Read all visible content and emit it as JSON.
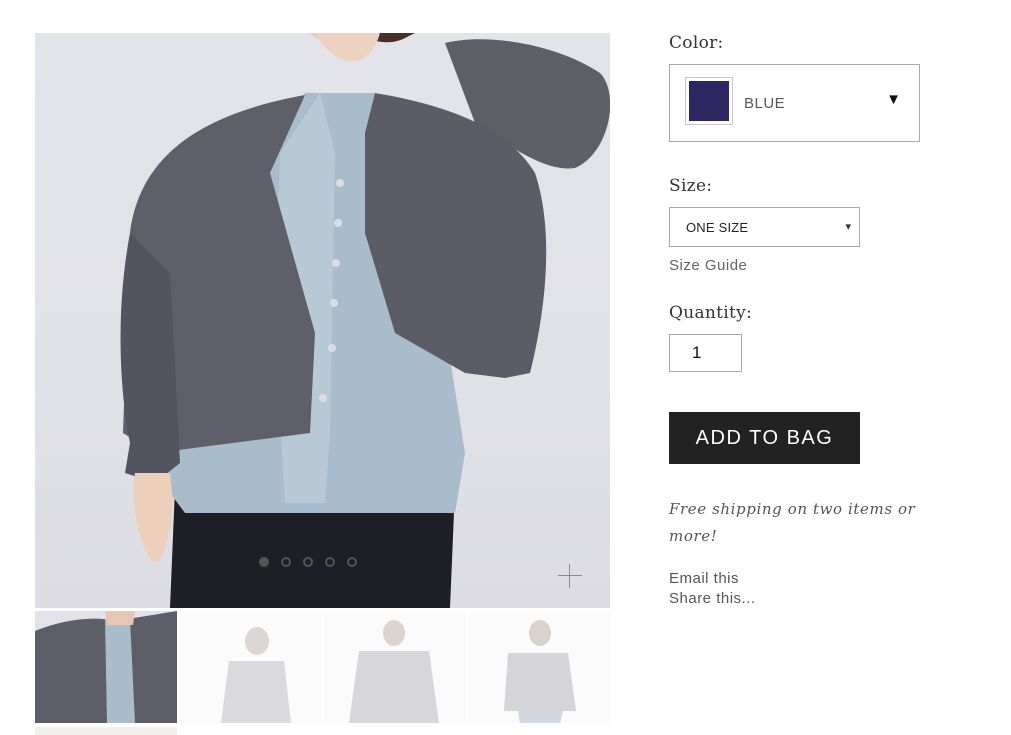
{
  "gallery": {
    "dot_count": 5,
    "active_dot": 0,
    "zoom_icon": "plus-icon"
  },
  "options": {
    "color": {
      "label": "Color:",
      "selected": "BLUE",
      "swatch_hex": "#2d2761",
      "caret_icon": "▼"
    },
    "size": {
      "label": "Size:",
      "selected": "ONE SIZE",
      "caret_icon": "▾",
      "guide_link": "Size Guide"
    },
    "quantity": {
      "label": "Quantity:",
      "value": "1"
    }
  },
  "cta": {
    "add_to_bag": "ADD TO BAG"
  },
  "notes": {
    "shipping": "Free shipping on two items or more!"
  },
  "links": {
    "email": "Email this",
    "share": "Share this..."
  },
  "colors": {
    "button_bg": "#222222",
    "swatch": "#2d2761",
    "border": "#a9a9a9"
  }
}
